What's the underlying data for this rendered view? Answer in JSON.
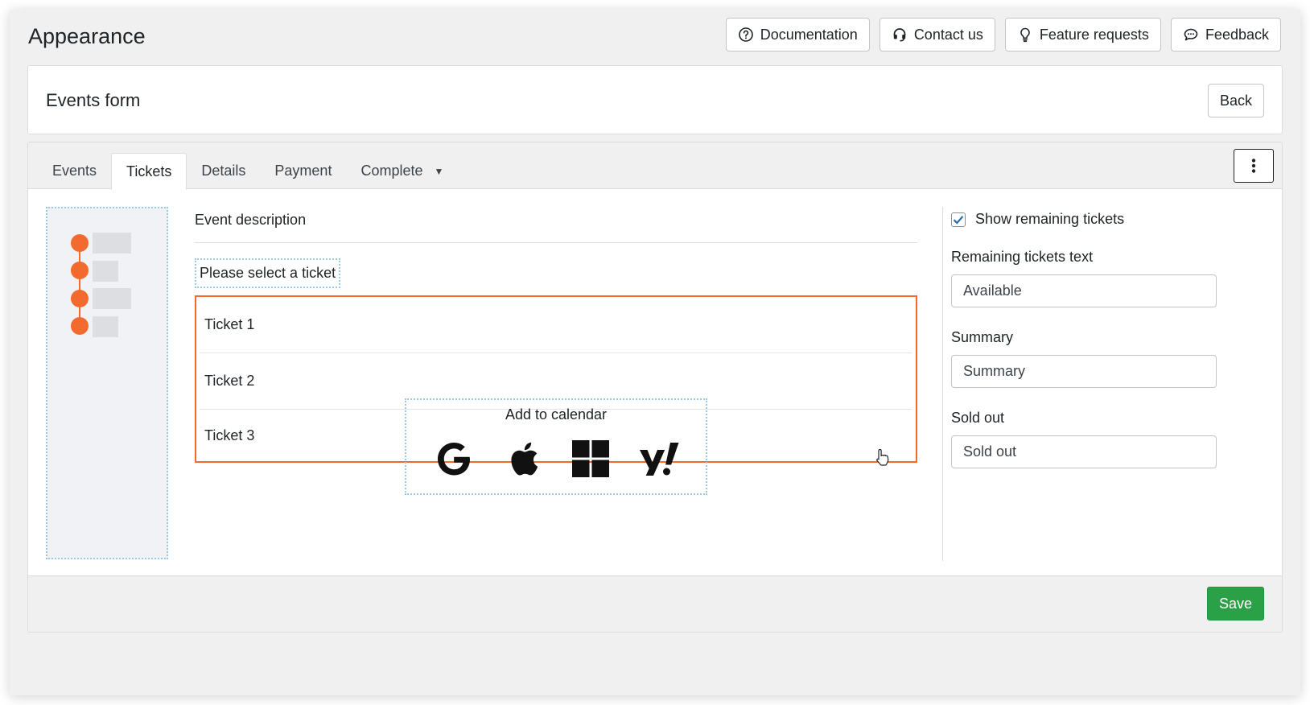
{
  "header": {
    "title": "Appearance",
    "actions": [
      {
        "label": "Documentation",
        "icon": "help-circle-icon"
      },
      {
        "label": "Contact us",
        "icon": "headset-icon"
      },
      {
        "label": "Feature requests",
        "icon": "lightbulb-icon"
      },
      {
        "label": "Feedback",
        "icon": "chat-icon"
      }
    ]
  },
  "form": {
    "title": "Events form",
    "back_label": "Back"
  },
  "tabs": [
    {
      "label": "Events"
    },
    {
      "label": "Tickets",
      "active": true
    },
    {
      "label": "Details"
    },
    {
      "label": "Payment"
    },
    {
      "label": "Complete",
      "has_dropdown": true
    }
  ],
  "preview": {
    "event_description": "Event description",
    "select_ticket": "Please select a ticket",
    "tickets": [
      "Ticket 1",
      "Ticket 2",
      "Ticket 3"
    ],
    "add_to_calendar": "Add to calendar",
    "calendar_icons": [
      "google-icon",
      "apple-icon",
      "windows-icon",
      "yahoo-icon"
    ]
  },
  "settings": {
    "show_remaining_label": "Show remaining tickets",
    "show_remaining_checked": true,
    "remaining_text_label": "Remaining tickets text",
    "remaining_text_value": "Available",
    "summary_label": "Summary",
    "summary_value": "Summary",
    "sold_out_label": "Sold out",
    "sold_out_value": "Sold out"
  },
  "footer": {
    "save_label": "Save"
  },
  "colors": {
    "accent_orange": "#f26a2e",
    "save_green": "#2aa146",
    "checkbox_blue": "#2271b1"
  }
}
